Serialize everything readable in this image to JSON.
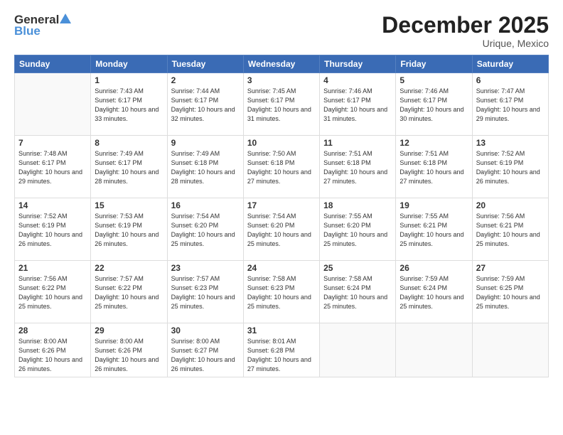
{
  "header": {
    "logo_general": "General",
    "logo_blue": "Blue",
    "title": "December 2025",
    "location": "Urique, Mexico"
  },
  "columns": [
    "Sunday",
    "Monday",
    "Tuesday",
    "Wednesday",
    "Thursday",
    "Friday",
    "Saturday"
  ],
  "weeks": [
    [
      {
        "day": "",
        "sunrise": "",
        "sunset": "",
        "daylight": ""
      },
      {
        "day": "1",
        "sunrise": "Sunrise: 7:43 AM",
        "sunset": "Sunset: 6:17 PM",
        "daylight": "Daylight: 10 hours and 33 minutes."
      },
      {
        "day": "2",
        "sunrise": "Sunrise: 7:44 AM",
        "sunset": "Sunset: 6:17 PM",
        "daylight": "Daylight: 10 hours and 32 minutes."
      },
      {
        "day": "3",
        "sunrise": "Sunrise: 7:45 AM",
        "sunset": "Sunset: 6:17 PM",
        "daylight": "Daylight: 10 hours and 31 minutes."
      },
      {
        "day": "4",
        "sunrise": "Sunrise: 7:46 AM",
        "sunset": "Sunset: 6:17 PM",
        "daylight": "Daylight: 10 hours and 31 minutes."
      },
      {
        "day": "5",
        "sunrise": "Sunrise: 7:46 AM",
        "sunset": "Sunset: 6:17 PM",
        "daylight": "Daylight: 10 hours and 30 minutes."
      },
      {
        "day": "6",
        "sunrise": "Sunrise: 7:47 AM",
        "sunset": "Sunset: 6:17 PM",
        "daylight": "Daylight: 10 hours and 29 minutes."
      }
    ],
    [
      {
        "day": "7",
        "sunrise": "Sunrise: 7:48 AM",
        "sunset": "Sunset: 6:17 PM",
        "daylight": "Daylight: 10 hours and 29 minutes."
      },
      {
        "day": "8",
        "sunrise": "Sunrise: 7:49 AM",
        "sunset": "Sunset: 6:17 PM",
        "daylight": "Daylight: 10 hours and 28 minutes."
      },
      {
        "day": "9",
        "sunrise": "Sunrise: 7:49 AM",
        "sunset": "Sunset: 6:18 PM",
        "daylight": "Daylight: 10 hours and 28 minutes."
      },
      {
        "day": "10",
        "sunrise": "Sunrise: 7:50 AM",
        "sunset": "Sunset: 6:18 PM",
        "daylight": "Daylight: 10 hours and 27 minutes."
      },
      {
        "day": "11",
        "sunrise": "Sunrise: 7:51 AM",
        "sunset": "Sunset: 6:18 PM",
        "daylight": "Daylight: 10 hours and 27 minutes."
      },
      {
        "day": "12",
        "sunrise": "Sunrise: 7:51 AM",
        "sunset": "Sunset: 6:18 PM",
        "daylight": "Daylight: 10 hours and 27 minutes."
      },
      {
        "day": "13",
        "sunrise": "Sunrise: 7:52 AM",
        "sunset": "Sunset: 6:19 PM",
        "daylight": "Daylight: 10 hours and 26 minutes."
      }
    ],
    [
      {
        "day": "14",
        "sunrise": "Sunrise: 7:52 AM",
        "sunset": "Sunset: 6:19 PM",
        "daylight": "Daylight: 10 hours and 26 minutes."
      },
      {
        "day": "15",
        "sunrise": "Sunrise: 7:53 AM",
        "sunset": "Sunset: 6:19 PM",
        "daylight": "Daylight: 10 hours and 26 minutes."
      },
      {
        "day": "16",
        "sunrise": "Sunrise: 7:54 AM",
        "sunset": "Sunset: 6:20 PM",
        "daylight": "Daylight: 10 hours and 25 minutes."
      },
      {
        "day": "17",
        "sunrise": "Sunrise: 7:54 AM",
        "sunset": "Sunset: 6:20 PM",
        "daylight": "Daylight: 10 hours and 25 minutes."
      },
      {
        "day": "18",
        "sunrise": "Sunrise: 7:55 AM",
        "sunset": "Sunset: 6:20 PM",
        "daylight": "Daylight: 10 hours and 25 minutes."
      },
      {
        "day": "19",
        "sunrise": "Sunrise: 7:55 AM",
        "sunset": "Sunset: 6:21 PM",
        "daylight": "Daylight: 10 hours and 25 minutes."
      },
      {
        "day": "20",
        "sunrise": "Sunrise: 7:56 AM",
        "sunset": "Sunset: 6:21 PM",
        "daylight": "Daylight: 10 hours and 25 minutes."
      }
    ],
    [
      {
        "day": "21",
        "sunrise": "Sunrise: 7:56 AM",
        "sunset": "Sunset: 6:22 PM",
        "daylight": "Daylight: 10 hours and 25 minutes."
      },
      {
        "day": "22",
        "sunrise": "Sunrise: 7:57 AM",
        "sunset": "Sunset: 6:22 PM",
        "daylight": "Daylight: 10 hours and 25 minutes."
      },
      {
        "day": "23",
        "sunrise": "Sunrise: 7:57 AM",
        "sunset": "Sunset: 6:23 PM",
        "daylight": "Daylight: 10 hours and 25 minutes."
      },
      {
        "day": "24",
        "sunrise": "Sunrise: 7:58 AM",
        "sunset": "Sunset: 6:23 PM",
        "daylight": "Daylight: 10 hours and 25 minutes."
      },
      {
        "day": "25",
        "sunrise": "Sunrise: 7:58 AM",
        "sunset": "Sunset: 6:24 PM",
        "daylight": "Daylight: 10 hours and 25 minutes."
      },
      {
        "day": "26",
        "sunrise": "Sunrise: 7:59 AM",
        "sunset": "Sunset: 6:24 PM",
        "daylight": "Daylight: 10 hours and 25 minutes."
      },
      {
        "day": "27",
        "sunrise": "Sunrise: 7:59 AM",
        "sunset": "Sunset: 6:25 PM",
        "daylight": "Daylight: 10 hours and 25 minutes."
      }
    ],
    [
      {
        "day": "28",
        "sunrise": "Sunrise: 8:00 AM",
        "sunset": "Sunset: 6:26 PM",
        "daylight": "Daylight: 10 hours and 26 minutes."
      },
      {
        "day": "29",
        "sunrise": "Sunrise: 8:00 AM",
        "sunset": "Sunset: 6:26 PM",
        "daylight": "Daylight: 10 hours and 26 minutes."
      },
      {
        "day": "30",
        "sunrise": "Sunrise: 8:00 AM",
        "sunset": "Sunset: 6:27 PM",
        "daylight": "Daylight: 10 hours and 26 minutes."
      },
      {
        "day": "31",
        "sunrise": "Sunrise: 8:01 AM",
        "sunset": "Sunset: 6:28 PM",
        "daylight": "Daylight: 10 hours and 27 minutes."
      },
      {
        "day": "",
        "sunrise": "",
        "sunset": "",
        "daylight": ""
      },
      {
        "day": "",
        "sunrise": "",
        "sunset": "",
        "daylight": ""
      },
      {
        "day": "",
        "sunrise": "",
        "sunset": "",
        "daylight": ""
      }
    ]
  ]
}
